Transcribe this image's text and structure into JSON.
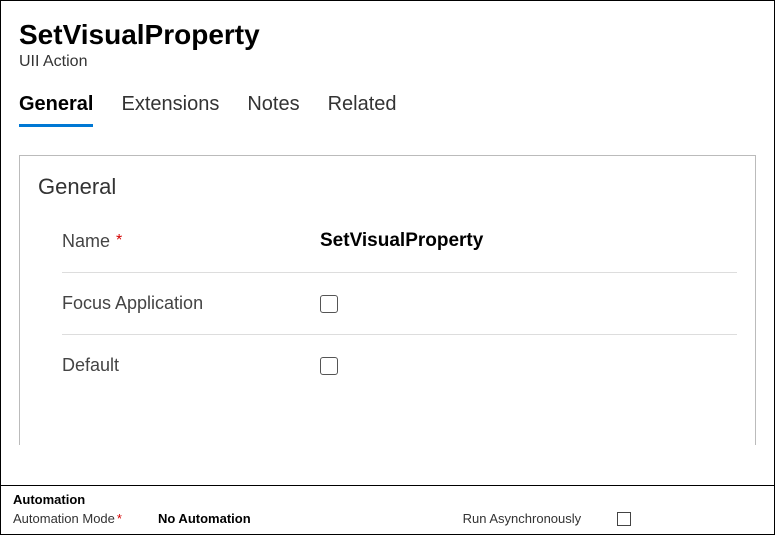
{
  "header": {
    "title": "SetVisualProperty",
    "subtitle": "UII Action"
  },
  "tabs": [
    {
      "label": "General",
      "active": true
    },
    {
      "label": "Extensions",
      "active": false
    },
    {
      "label": "Notes",
      "active": false
    },
    {
      "label": "Related",
      "active": false
    }
  ],
  "general": {
    "section_title": "General",
    "fields": {
      "name": {
        "label": "Name",
        "required": "*",
        "value": "SetVisualProperty"
      },
      "focus_application": {
        "label": "Focus Application",
        "checked": false
      },
      "default": {
        "label": "Default",
        "checked": false
      }
    }
  },
  "automation": {
    "title": "Automation",
    "mode": {
      "label": "Automation Mode",
      "required": "*",
      "value": "No Automation"
    },
    "run_async": {
      "label": "Run Asynchronously",
      "checked": false
    }
  }
}
